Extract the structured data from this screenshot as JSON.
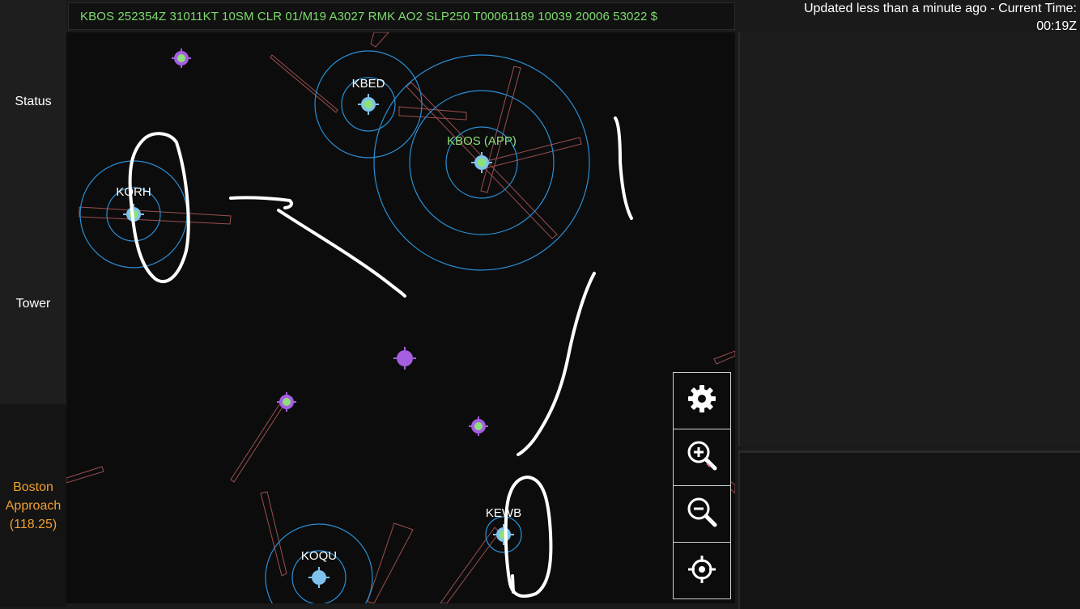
{
  "sidebar": {
    "status_label": "Status",
    "tower_label": "Tower",
    "approach_label": "Boston\nApproach\n(118.25)"
  },
  "metar": "KBOS 252354Z 31011KT 10SM CLR 01/M19 A3027 RMK AO2 SLP250 T00061189 10039 20006 53022 $",
  "update_status": {
    "line1": "Updated less than a minute ago - Current Time:",
    "line2": "00:19Z"
  },
  "map": {
    "airports": [
      {
        "id": "KBED",
        "label": "KBED"
      },
      {
        "id": "KBOS",
        "label": "KBOS (APP)"
      },
      {
        "id": "KORH",
        "label": "KORH"
      },
      {
        "id": "KEWB",
        "label": "KEWB"
      },
      {
        "id": "KOQU",
        "label": "KOQU"
      }
    ]
  },
  "controls": {
    "settings_icon": "gear-icon",
    "zoom_in_icon": "zoom-in-icon",
    "zoom_out_icon": "zoom-out-icon",
    "recenter_icon": "crosshair-icon"
  },
  "colors": {
    "metar_text": "#7ddc6e",
    "approach_label": "#f0a030",
    "airport_ring": "#2a8fd6",
    "runway": "#c06060",
    "unlabeled_marker": "#a65ee0",
    "annotation": "#ffffff"
  }
}
